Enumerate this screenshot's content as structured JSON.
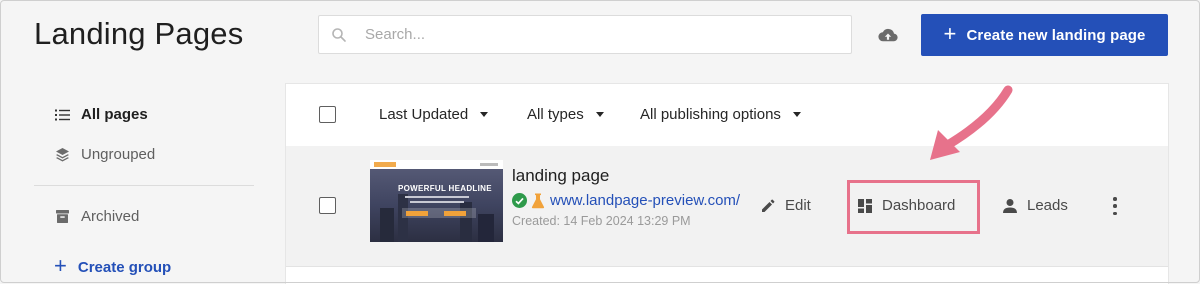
{
  "header": {
    "title": "Landing Pages",
    "search_placeholder": "Search...",
    "create_button_label": "Create new landing page"
  },
  "sidebar": {
    "items": [
      {
        "label": "All pages",
        "icon": "list-icon",
        "active": true
      },
      {
        "label": "Ungrouped",
        "icon": "layers-icon",
        "active": false
      },
      {
        "label": "Archived",
        "icon": "archive-icon",
        "active": false
      }
    ],
    "create_group_label": "Create group"
  },
  "filters": {
    "sort_label": "Last Updated",
    "type_label": "All types",
    "publishing_label": "All publishing options"
  },
  "rows": [
    {
      "name": "landing page",
      "url": "www.landpage-preview.com/",
      "created": "Created: 14 Feb 2024 13:29 PM",
      "thumbnail_headline": "POWERFUL HEADLINE",
      "actions": {
        "edit": "Edit",
        "dashboard": "Dashboard",
        "leads": "Leads"
      }
    }
  ],
  "colors": {
    "accent": "#2450b8",
    "highlight": "#e7728b",
    "success": "#2e9a4b",
    "test_flask": "#f1a23a"
  },
  "icons": [
    "search-icon",
    "cloud-upload-icon",
    "plus-icon",
    "list-icon",
    "layers-icon",
    "archive-icon",
    "check-circle-icon",
    "flask-icon",
    "pencil-icon",
    "dashboard-icon",
    "person-icon",
    "more-vertical-icon"
  ]
}
